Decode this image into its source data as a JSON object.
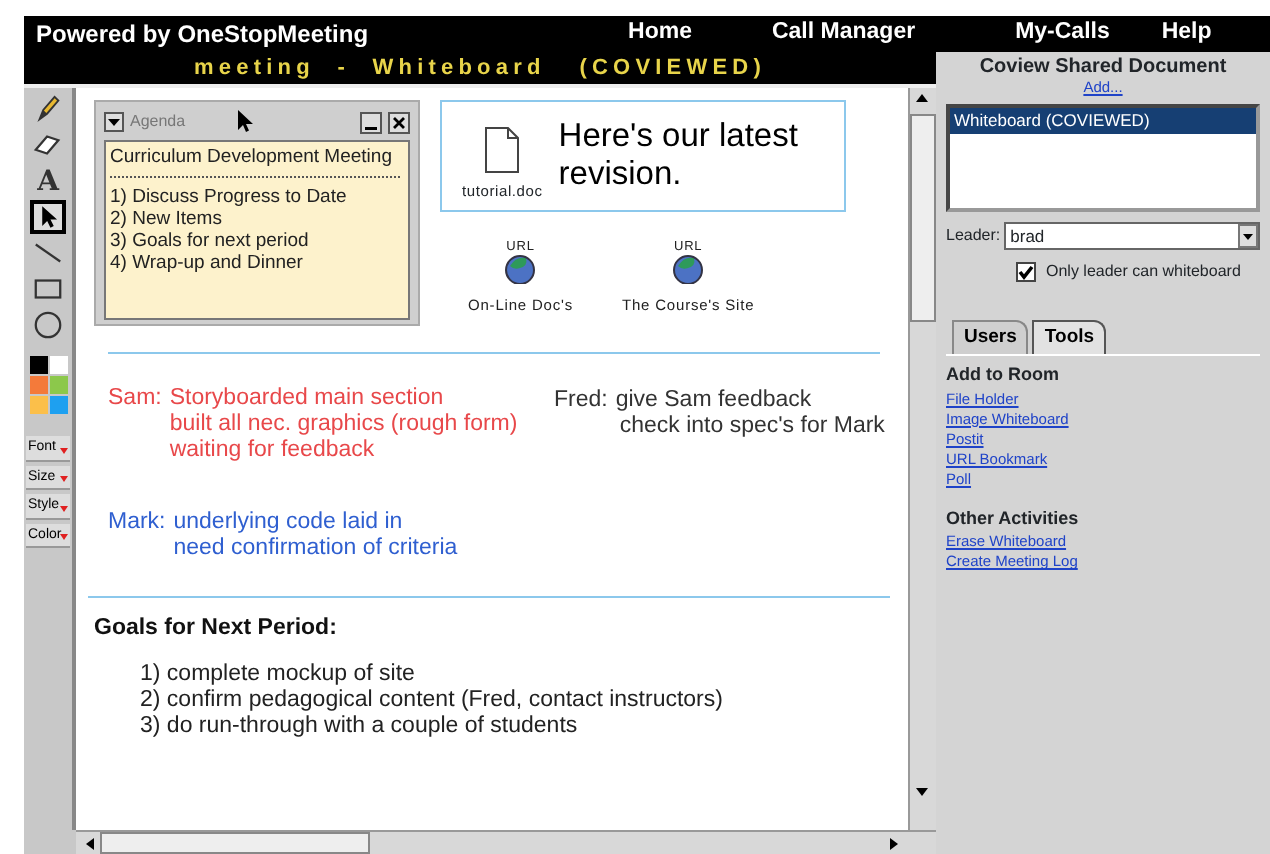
{
  "top_nav": {
    "brand": "Powered by OneStopMeeting",
    "links": [
      "Home",
      "Call Manager",
      "My-Calls",
      "Help"
    ]
  },
  "title_bar": "meeting - Whiteboard (COVIEWED)",
  "tools": [
    {
      "kind": "pencil",
      "selected": false
    },
    {
      "kind": "eraser",
      "selected": false
    },
    {
      "kind": "text",
      "label": "A",
      "selected": false
    },
    {
      "kind": "pointer",
      "selected": true
    },
    {
      "kind": "line",
      "selected": false
    },
    {
      "kind": "rectangle",
      "selected": false
    },
    {
      "kind": "ellipse",
      "selected": false
    }
  ],
  "palette": [
    {
      "color": "#000000"
    },
    {
      "color": "#ffffff"
    },
    {
      "color": "#f47a3a"
    },
    {
      "color": "#8cc84b"
    },
    {
      "color": "#fbbf4a"
    },
    {
      "color": "#1ea0f0"
    }
  ],
  "format_menus": [
    "Font",
    "Size",
    "Style",
    "Color"
  ],
  "agenda": {
    "title": "Agenda",
    "heading": "Curriculum Development Meeting",
    "items": [
      "1) Discuss Progress to Date",
      "2) New Items",
      "3) Goals for next period",
      "4) Wrap-up and Dinner"
    ]
  },
  "file_note": {
    "file": "tutorial.doc",
    "message": "Here's our latest revision."
  },
  "bookmarks": [
    {
      "badge": "URL",
      "label": "On-Line Doc's"
    },
    {
      "badge": "URL",
      "label": "The Course's Site"
    }
  ],
  "notes": [
    {
      "speaker": "Sam:",
      "lines": [
        "Storyboarded main section",
        "built all nec. graphics (rough form)",
        "waiting for feedback"
      ],
      "color": "#e8484a"
    },
    {
      "speaker": "Fred:",
      "lines": [
        "give Sam feedback",
        "check into spec's for Mark"
      ],
      "color": "#333333"
    },
    {
      "speaker": "Mark:",
      "lines": [
        "underlying code laid in",
        "need confirmation of criteria"
      ],
      "color": "#2f5fd0"
    }
  ],
  "goals": {
    "heading": "Goals for Next Period:",
    "items": [
      "1) complete mockup of site",
      "2) confirm pedagogical content (Fred, contact instructors)",
      "3) do run-through with a couple of students"
    ]
  },
  "shared_documents": {
    "title": "Coview Shared Document",
    "add_link": "Add...",
    "items": [
      {
        "label": "Whiteboard (COVIEWED)",
        "selected": true
      }
    ]
  },
  "leader": {
    "label": "Leader:",
    "value": "brad"
  },
  "only_leader": {
    "label": "Only leader can whiteboard",
    "checked": true
  },
  "tabs": [
    {
      "label": "Users",
      "selected": false
    },
    {
      "label": "Tools",
      "selected": true
    }
  ],
  "sections": [
    {
      "heading": "Add to Room",
      "links": [
        "File Holder",
        "Image Whiteboard",
        "Postit",
        "URL Bookmark",
        "Poll"
      ]
    },
    {
      "heading": "Other Activities",
      "links": [
        "Erase Whiteboard",
        "Create Meeting Log"
      ]
    }
  ]
}
